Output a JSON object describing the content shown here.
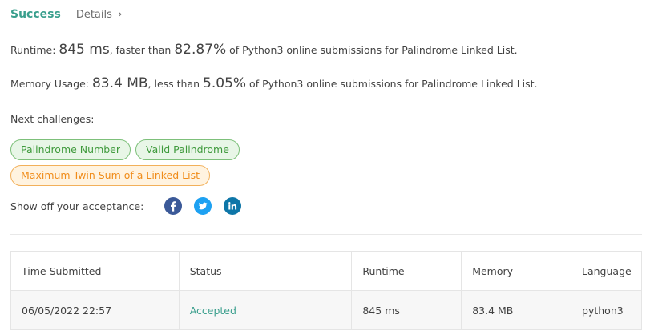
{
  "header": {
    "status": "Success",
    "details_label": "Details",
    "details_chevron": "›"
  },
  "runtime": {
    "label": "Runtime:",
    "value": "845 ms",
    "comparison": ", faster than",
    "percent": "82.87%",
    "suffix": "of Python3 online submissions for Palindrome Linked List."
  },
  "memory": {
    "label": "Memory Usage:",
    "value": "83.4 MB",
    "comparison": ", less than",
    "percent": "5.05%",
    "suffix": "of Python3 online submissions for Palindrome Linked List."
  },
  "next": {
    "label": "Next challenges:",
    "challenges": [
      {
        "label": "Palindrome Number",
        "color": "green"
      },
      {
        "label": "Valid Palindrome",
        "color": "green"
      },
      {
        "label": "Maximum Twin Sum of a Linked List",
        "color": "orange"
      }
    ]
  },
  "share": {
    "label": "Show off your acceptance:",
    "icons": [
      "facebook-icon",
      "twitter-icon",
      "linkedin-icon"
    ]
  },
  "table": {
    "headers": [
      "Time Submitted",
      "Status",
      "Runtime",
      "Memory",
      "Language"
    ],
    "rows": [
      [
        "06/05/2022 22:57",
        "Accepted",
        "845 ms",
        "83.4 MB",
        "python3"
      ]
    ]
  },
  "colors": {
    "accent": "#3a9f8d",
    "tag_green": "#3f9a3c",
    "tag_orange": "#f08c1a",
    "facebook": "#3b5998",
    "twitter": "#1da1f2",
    "linkedin": "#0e76a8"
  }
}
